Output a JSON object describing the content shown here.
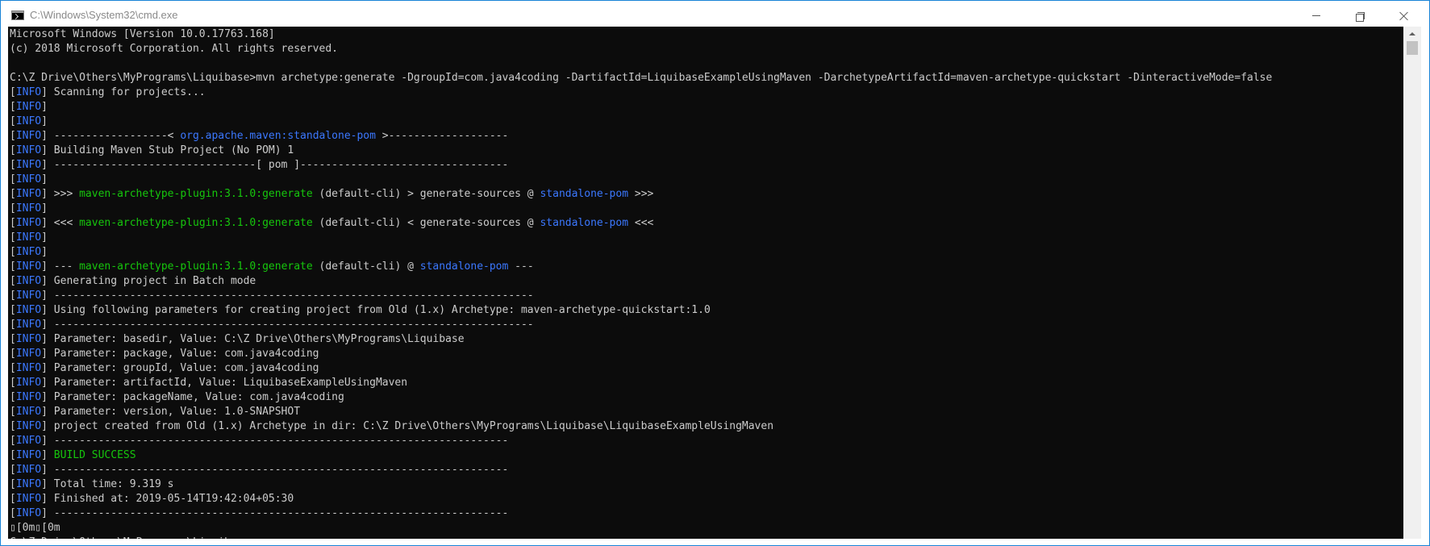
{
  "window": {
    "title": "C:\\Windows\\System32\\cmd.exe"
  },
  "console": {
    "lines": [
      [
        {
          "t": "Microsoft Windows [Version 10.0.17763.168]"
        }
      ],
      [
        {
          "t": "(c) 2018 Microsoft Corporation. All rights reserved."
        }
      ],
      [
        {
          "t": ""
        }
      ],
      [
        {
          "t": "C:\\Z Drive\\Others\\MyPrograms\\Liquibase>mvn archetype:generate -DgroupId=com.java4coding -DartifactId=LiquibaseExampleUsingMaven -DarchetypeArtifactId=maven-archetype-quickstart -DinteractiveMode=false"
        }
      ],
      [
        {
          "t": "["
        },
        {
          "t": "INFO",
          "c": "info"
        },
        {
          "t": "] Scanning for projects..."
        }
      ],
      [
        {
          "t": "["
        },
        {
          "t": "INFO",
          "c": "info"
        },
        {
          "t": "]"
        }
      ],
      [
        {
          "t": "["
        },
        {
          "t": "INFO",
          "c": "info"
        },
        {
          "t": "]"
        }
      ],
      [
        {
          "t": "["
        },
        {
          "t": "INFO",
          "c": "info"
        },
        {
          "t": "] ------------------< "
        },
        {
          "t": "org.apache.maven:standalone-pom",
          "c": "blue"
        },
        {
          "t": " >-------------------"
        }
      ],
      [
        {
          "t": "["
        },
        {
          "t": "INFO",
          "c": "info"
        },
        {
          "t": "] Building Maven Stub Project (No POM) 1"
        }
      ],
      [
        {
          "t": "["
        },
        {
          "t": "INFO",
          "c": "info"
        },
        {
          "t": "] --------------------------------[ pom ]---------------------------------"
        }
      ],
      [
        {
          "t": "["
        },
        {
          "t": "INFO",
          "c": "info"
        },
        {
          "t": "]"
        }
      ],
      [
        {
          "t": "["
        },
        {
          "t": "INFO",
          "c": "info"
        },
        {
          "t": "] >>> "
        },
        {
          "t": "maven-archetype-plugin:3.1.0:generate",
          "c": "green"
        },
        {
          "t": " (default-cli) > generate-sources @ "
        },
        {
          "t": "standalone-pom",
          "c": "blue"
        },
        {
          "t": " >>>"
        }
      ],
      [
        {
          "t": "["
        },
        {
          "t": "INFO",
          "c": "info"
        },
        {
          "t": "]"
        }
      ],
      [
        {
          "t": "["
        },
        {
          "t": "INFO",
          "c": "info"
        },
        {
          "t": "] <<< "
        },
        {
          "t": "maven-archetype-plugin:3.1.0:generate",
          "c": "green"
        },
        {
          "t": " (default-cli) < generate-sources @ "
        },
        {
          "t": "standalone-pom",
          "c": "blue"
        },
        {
          "t": " <<<"
        }
      ],
      [
        {
          "t": "["
        },
        {
          "t": "INFO",
          "c": "info"
        },
        {
          "t": "]"
        }
      ],
      [
        {
          "t": "["
        },
        {
          "t": "INFO",
          "c": "info"
        },
        {
          "t": "]"
        }
      ],
      [
        {
          "t": "["
        },
        {
          "t": "INFO",
          "c": "info"
        },
        {
          "t": "] --- "
        },
        {
          "t": "maven-archetype-plugin:3.1.0:generate",
          "c": "green"
        },
        {
          "t": " (default-cli) @ "
        },
        {
          "t": "standalone-pom",
          "c": "blue"
        },
        {
          "t": " ---"
        }
      ],
      [
        {
          "t": "["
        },
        {
          "t": "INFO",
          "c": "info"
        },
        {
          "t": "] Generating project in Batch mode"
        }
      ],
      [
        {
          "t": "["
        },
        {
          "t": "INFO",
          "c": "info"
        },
        {
          "t": "] ----------------------------------------------------------------------------"
        }
      ],
      [
        {
          "t": "["
        },
        {
          "t": "INFO",
          "c": "info"
        },
        {
          "t": "] Using following parameters for creating project from Old (1.x) Archetype: maven-archetype-quickstart:1.0"
        }
      ],
      [
        {
          "t": "["
        },
        {
          "t": "INFO",
          "c": "info"
        },
        {
          "t": "] ----------------------------------------------------------------------------"
        }
      ],
      [
        {
          "t": "["
        },
        {
          "t": "INFO",
          "c": "info"
        },
        {
          "t": "] Parameter: basedir, Value: C:\\Z Drive\\Others\\MyPrograms\\Liquibase"
        }
      ],
      [
        {
          "t": "["
        },
        {
          "t": "INFO",
          "c": "info"
        },
        {
          "t": "] Parameter: package, Value: com.java4coding"
        }
      ],
      [
        {
          "t": "["
        },
        {
          "t": "INFO",
          "c": "info"
        },
        {
          "t": "] Parameter: groupId, Value: com.java4coding"
        }
      ],
      [
        {
          "t": "["
        },
        {
          "t": "INFO",
          "c": "info"
        },
        {
          "t": "] Parameter: artifactId, Value: LiquibaseExampleUsingMaven"
        }
      ],
      [
        {
          "t": "["
        },
        {
          "t": "INFO",
          "c": "info"
        },
        {
          "t": "] Parameter: packageName, Value: com.java4coding"
        }
      ],
      [
        {
          "t": "["
        },
        {
          "t": "INFO",
          "c": "info"
        },
        {
          "t": "] Parameter: version, Value: 1.0-SNAPSHOT"
        }
      ],
      [
        {
          "t": "["
        },
        {
          "t": "INFO",
          "c": "info"
        },
        {
          "t": "] project created from Old (1.x) Archetype in dir: C:\\Z Drive\\Others\\MyPrograms\\Liquibase\\LiquibaseExampleUsingMaven"
        }
      ],
      [
        {
          "t": "["
        },
        {
          "t": "INFO",
          "c": "info"
        },
        {
          "t": "] ------------------------------------------------------------------------"
        }
      ],
      [
        {
          "t": "["
        },
        {
          "t": "INFO",
          "c": "info"
        },
        {
          "t": "] "
        },
        {
          "t": "BUILD SUCCESS",
          "c": "green"
        }
      ],
      [
        {
          "t": "["
        },
        {
          "t": "INFO",
          "c": "info"
        },
        {
          "t": "] ------------------------------------------------------------------------"
        }
      ],
      [
        {
          "t": "["
        },
        {
          "t": "INFO",
          "c": "info"
        },
        {
          "t": "] Total time: 9.319 s"
        }
      ],
      [
        {
          "t": "["
        },
        {
          "t": "INFO",
          "c": "info"
        },
        {
          "t": "] Finished at: 2019-05-14T19:42:04+05:30"
        }
      ],
      [
        {
          "t": "["
        },
        {
          "t": "INFO",
          "c": "info"
        },
        {
          "t": "] ------------------------------------------------------------------------"
        }
      ],
      [
        {
          "t": "▯[0m▯[0m"
        }
      ],
      [
        {
          "t": "C:\\Z Drive\\Others\\MyPrograms\\Liquibase>"
        }
      ]
    ]
  },
  "colors": {
    "console_bg": "#0c0c0c",
    "console_fg": "#cccccc",
    "info": "#3b78ff",
    "blue": "#3b78ff",
    "green": "#16c60c",
    "window_border": "#1883d7"
  }
}
